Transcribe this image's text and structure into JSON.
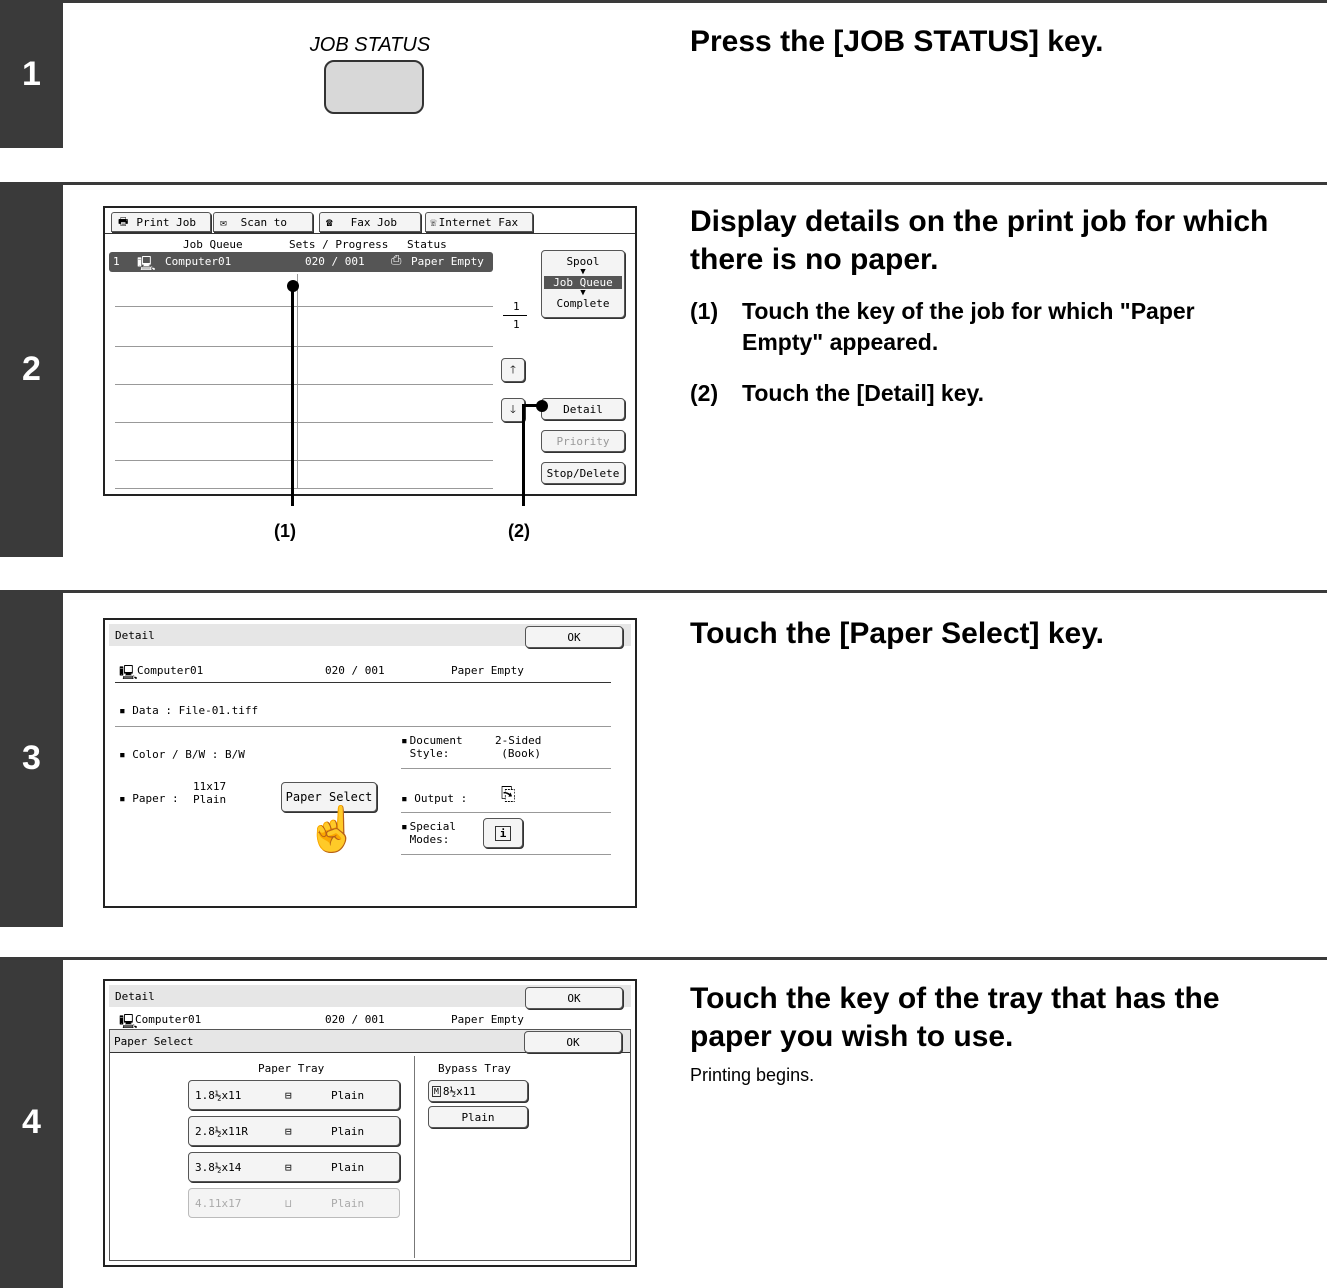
{
  "step1": {
    "number": "1",
    "key_label": "JOB STATUS",
    "heading": "Press the [JOB STATUS] key."
  },
  "step2": {
    "number": "2",
    "heading_line1": "Display details on the print job for which",
    "heading_line2": "there is no paper.",
    "sub1_num": "(1)",
    "sub1_line1": "Touch the key of the job for which \"Paper",
    "sub1_line2": "Empty\" appeared.",
    "sub2_num": "(2)",
    "sub2_text": "Touch the [Detail] key.",
    "tabs": [
      "Print Job",
      "Scan to",
      "Fax Job",
      "Internet Fax"
    ],
    "col_job_queue": "Job Queue",
    "col_sets": "Sets / Progress",
    "col_status": "Status",
    "row": {
      "index": "1",
      "name": "Computer01",
      "sets": "020 / 001",
      "status": "Paper Empty"
    },
    "mode_spool": "Spool",
    "mode_job_queue": "Job Queue",
    "mode_complete": "Complete",
    "page_current": "1",
    "page_total": "1",
    "btn_detail": "Detail",
    "btn_priority": "Priority",
    "btn_stop": "Stop/Delete",
    "callout1": "(1)",
    "callout2": "(2)"
  },
  "step3": {
    "number": "3",
    "heading": "Touch the [Paper Select] key.",
    "title": "Detail",
    "ok": "OK",
    "job_name": "Computer01",
    "sets": "020 / 001",
    "status": "Paper Empty",
    "data_label": "Data : File-01.tiff",
    "color_label": "Color / B/W : B/W",
    "doc_style_label1": "Document",
    "doc_style_label2": "Style:",
    "doc_style_value1": "2-Sided",
    "doc_style_value2": "(Book)",
    "paper_label": "Paper :",
    "paper_size": "11x17",
    "paper_type": "Plain",
    "paper_select_btn": "Paper Select",
    "output_label": "Output :",
    "special_label1": "Special",
    "special_label2": "Modes:"
  },
  "step4": {
    "number": "4",
    "heading_line1": "Touch the key of the tray that has the",
    "heading_line2": "paper you wish to use.",
    "body": "Printing begins.",
    "title": "Detail",
    "ok": "OK",
    "job_name": "Computer01",
    "sets": "020 / 001",
    "status": "Paper Empty",
    "paper_select_title": "Paper Select",
    "ok2": "OK",
    "paper_tray_label": "Paper Tray",
    "bypass_tray_label": "Bypass Tray",
    "trays": [
      {
        "id": "1.8½x11",
        "type": "Plain"
      },
      {
        "id": "2.8½x11R",
        "type": "Plain"
      },
      {
        "id": "3.8½x14",
        "type": "Plain"
      },
      {
        "id": "4.11x17",
        "type": "Plain"
      }
    ],
    "bypass_size": "8½x11",
    "bypass_type": "Plain"
  }
}
